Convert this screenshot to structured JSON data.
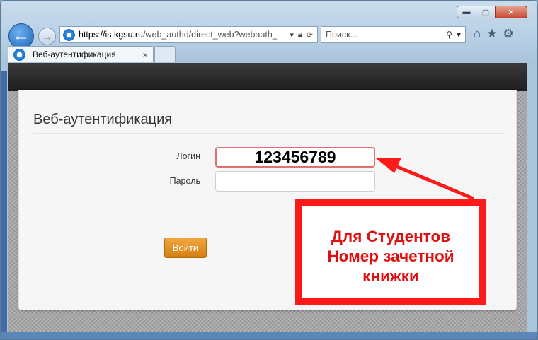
{
  "browser": {
    "url_host": "https://is.kgsu.ru",
    "url_path": "/web_authd/direct_web?webauth_",
    "search_placeholder": "Поиск...",
    "tab_title": "Веб-аутентификация",
    "tab_close": "×",
    "icons": [
      "back-arrow-icon",
      "forward-arrow-icon",
      "ie-logo-icon",
      "lock-icon",
      "refresh-icon",
      "search-icon",
      "home-icon",
      "favorites-star-icon",
      "gear-icon"
    ]
  },
  "window_controls": {
    "minimize": "▬",
    "maximize": "▢",
    "close": "✕"
  },
  "form": {
    "title": "Веб-аутентификация",
    "login_label": "Логин",
    "login_value": "123456789",
    "password_label": "Пароль",
    "password_value": "",
    "submit_label": "Войти"
  },
  "annotation": {
    "text": "Для Студентов\nНомер зачетной\nкнижки",
    "color": "#ff1a1a"
  },
  "colors": {
    "button_orange": "#e0901f",
    "accent_red": "#ff1a1a",
    "header_dark": "#262626"
  }
}
